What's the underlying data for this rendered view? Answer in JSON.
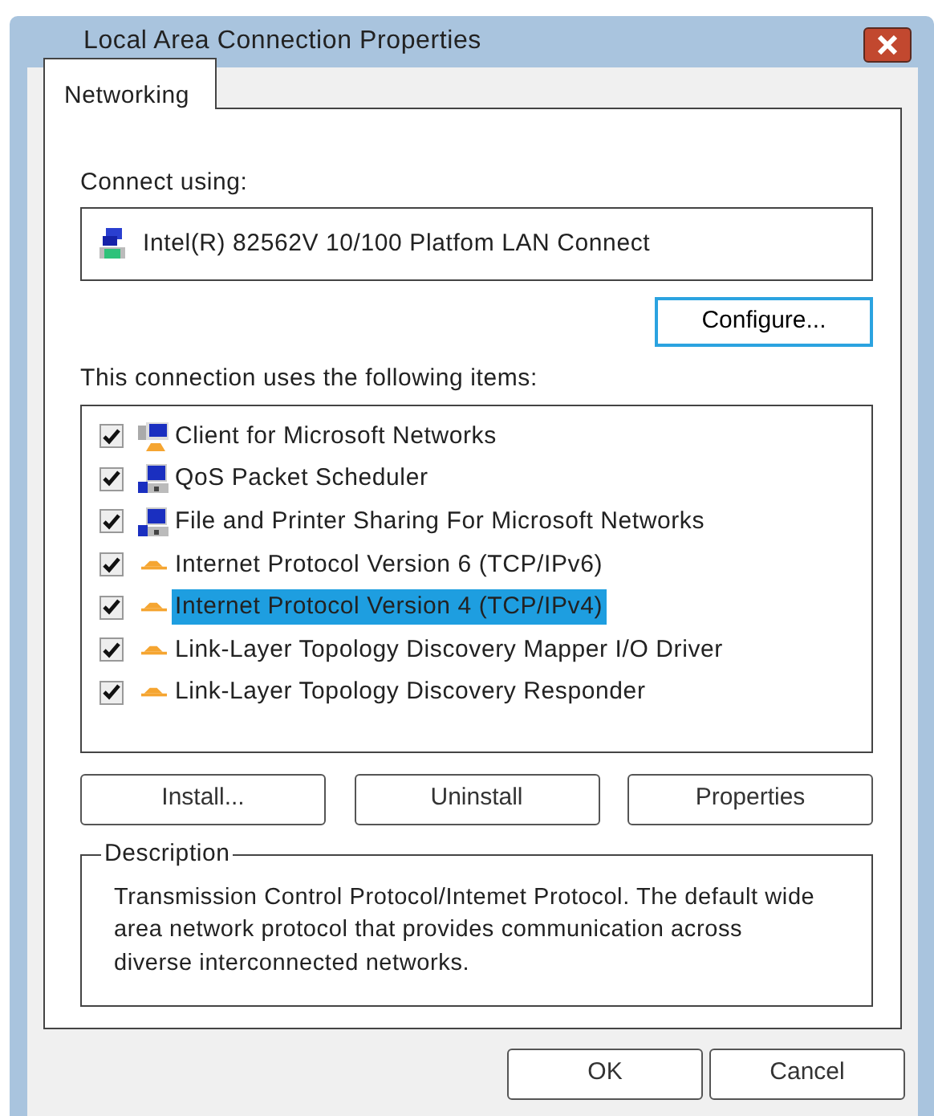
{
  "window": {
    "title": "Local Area Connection Properties"
  },
  "tabs": [
    {
      "label": "Networking",
      "selected": true
    }
  ],
  "connect_using": {
    "label": "Connect using:",
    "adapter": "Intel(R) 82562V 10/100 Platfom LAN Connect",
    "configure_button": "Configure..."
  },
  "items_label": "This connection uses the following items:",
  "items": [
    {
      "label": "Client for Microsoft Networks",
      "kind": "client",
      "checked": true,
      "selected": false
    },
    {
      "label": "QoS Packet Scheduler",
      "kind": "service",
      "checked": true,
      "selected": false
    },
    {
      "label": "File and Printer Sharing For Microsoft Networks",
      "kind": "service",
      "checked": true,
      "selected": false
    },
    {
      "label": "Internet Protocol Version 6 (TCP/IPv6)",
      "kind": "protocol",
      "checked": true,
      "selected": false
    },
    {
      "label": "Internet Protocol Version 4 (TCP/IPv4)",
      "kind": "protocol",
      "checked": true,
      "selected": true
    },
    {
      "label": "Link-Layer Topology Discovery Mapper I/O Driver",
      "kind": "protocol",
      "checked": true,
      "selected": false
    },
    {
      "label": "Link-Layer Topology Discovery Responder",
      "kind": "protocol",
      "checked": true,
      "selected": false
    }
  ],
  "item_buttons": [
    "Install...",
    "Uninstall",
    "Properties"
  ],
  "description": {
    "legend": "Description",
    "text": "Transmission Control Protocol/Intemet Protocol. The default wide area network protocol that provides communication across diverse interconnected networks."
  },
  "buttons": [
    "OK",
    "Cancel"
  ]
}
